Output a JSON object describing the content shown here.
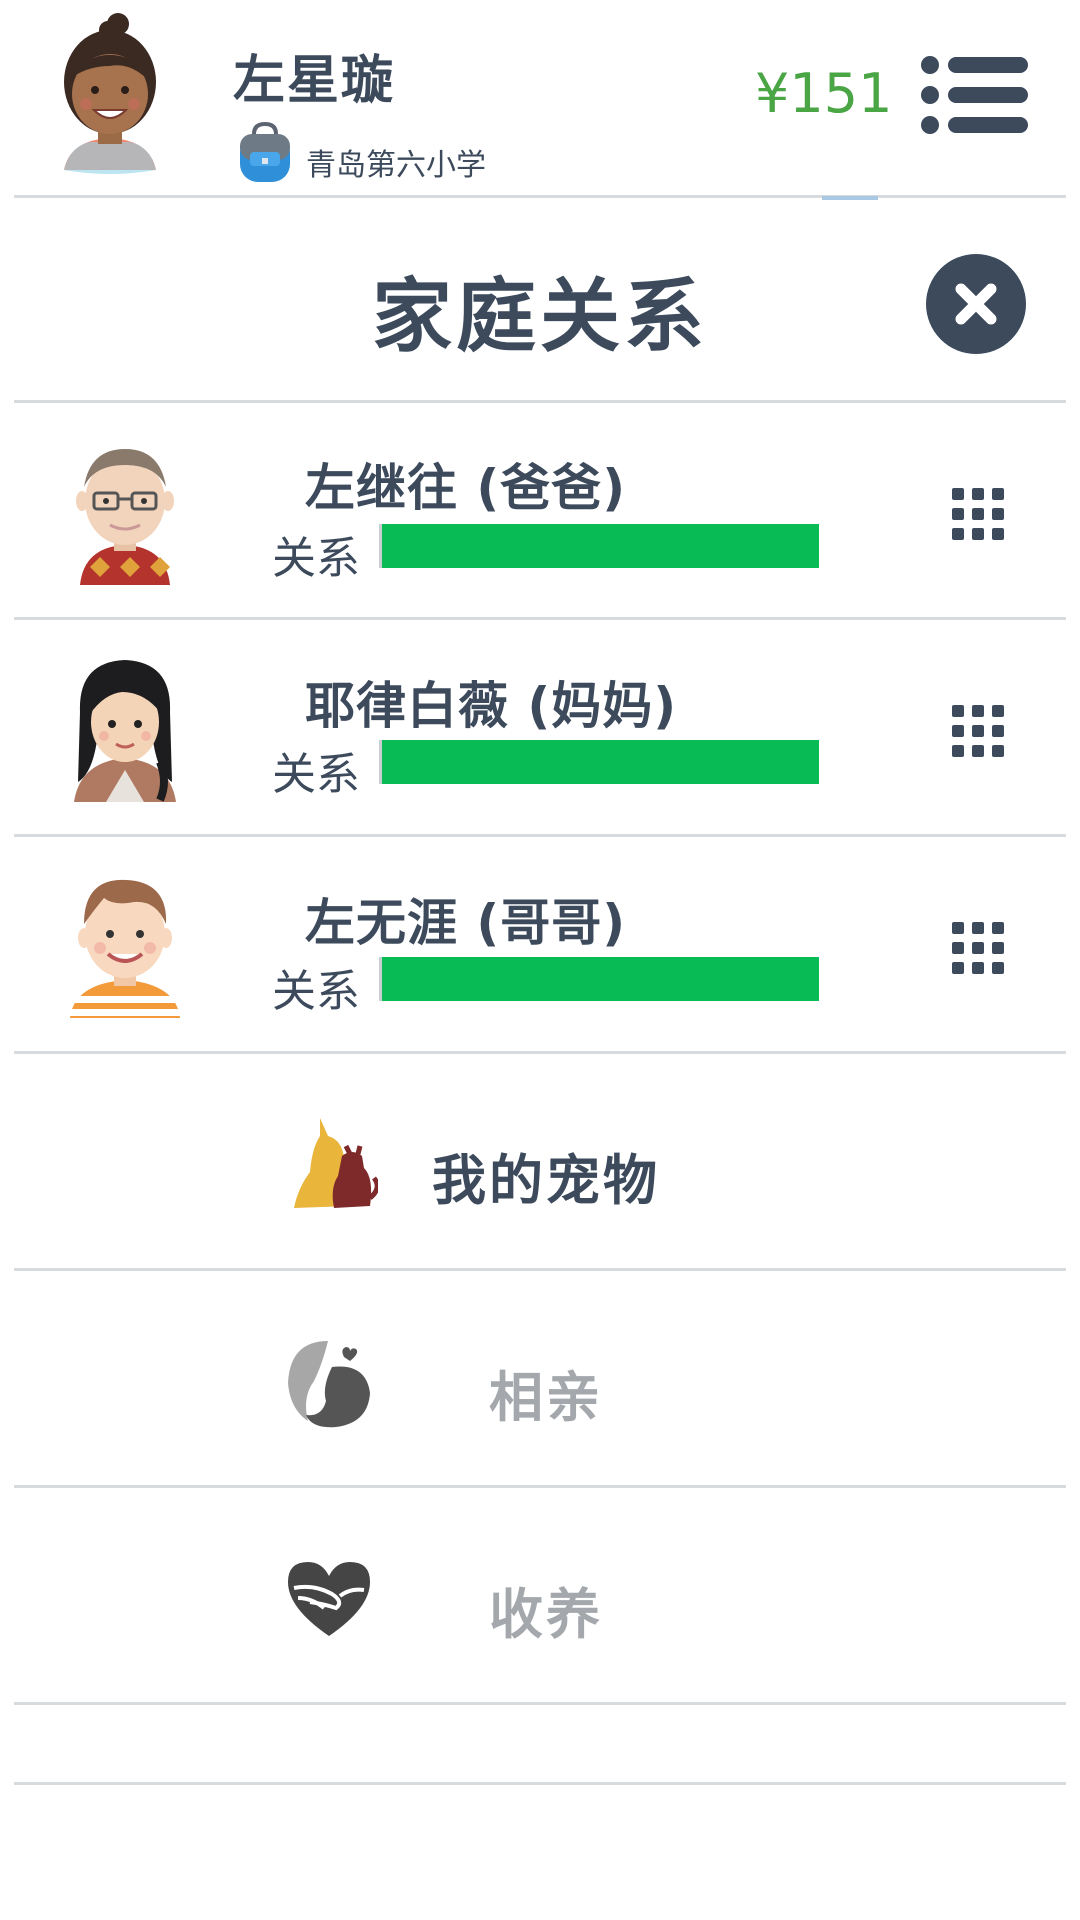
{
  "header": {
    "player_name": "左星璇",
    "school": "青岛第六小学",
    "money": "¥151"
  },
  "page": {
    "title": "家庭关系"
  },
  "relations": [
    {
      "name": "左继往 (爸爸)",
      "bar_label": "关系",
      "level": 1.0
    },
    {
      "name": "耶律白薇 (妈妈)",
      "bar_label": "关系",
      "level": 1.0
    },
    {
      "name": "左无涯 (哥哥)",
      "bar_label": "关系",
      "level": 1.0
    }
  ],
  "actions": [
    {
      "label": "我的宠物",
      "enabled": true
    },
    {
      "label": "相亲",
      "enabled": false
    },
    {
      "label": "收养",
      "enabled": false
    }
  ],
  "colors": {
    "text": "#3c4a5c",
    "money": "#4aa545",
    "bar": "#08bb55",
    "disabled": "#a4a8ad"
  },
  "icons": {
    "menu": "menu-list-icon",
    "close": "close-icon",
    "more": "grid-dots-icon",
    "school": "backpack-icon",
    "pets": "pets-icon",
    "dating": "couple-icon",
    "adopt": "heart-hands-icon"
  }
}
